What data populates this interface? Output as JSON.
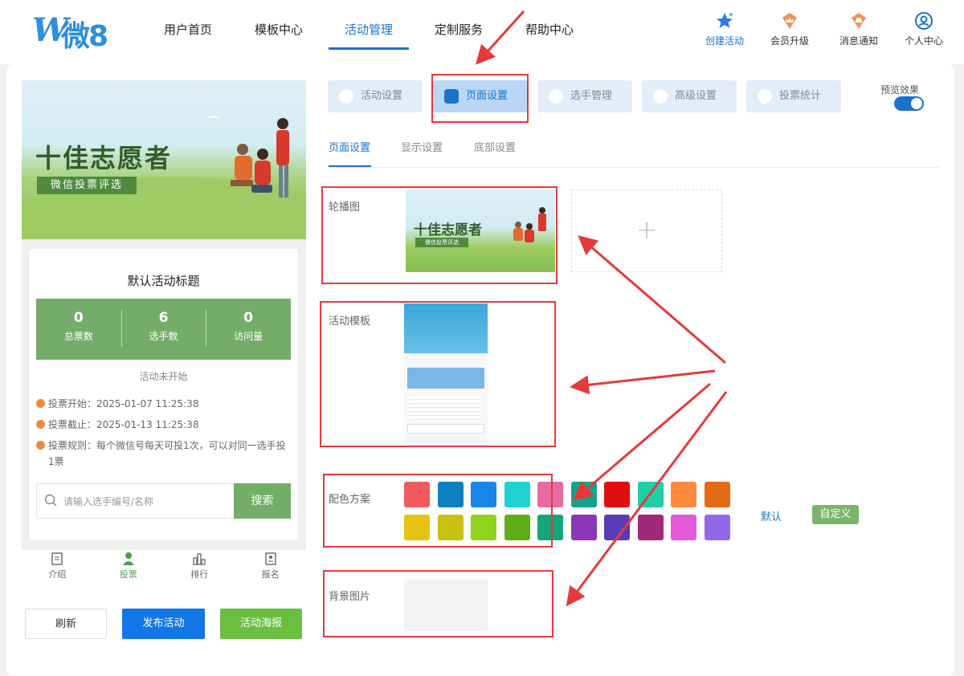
{
  "brand": {
    "logo_text": "微8",
    "logo_mark": "W"
  },
  "nav": {
    "items": [
      "用户首页",
      "模板中心",
      "活动管理",
      "定制服务",
      "帮助中心"
    ],
    "active_index": 2,
    "right": [
      {
        "label": "创建活动",
        "icon": "star-icon"
      },
      {
        "label": "会员升级",
        "icon": "crown-badge-icon"
      },
      {
        "label": "消息通知",
        "icon": "bell-badge-icon"
      },
      {
        "label": "个人中心",
        "icon": "user-circle-icon"
      }
    ]
  },
  "preview": {
    "banner_title": "十佳志愿者",
    "banner_subtitle": "微信投票评选",
    "activity_title": "默认活动标题",
    "stats": [
      {
        "value": "0",
        "label": "总票数"
      },
      {
        "value": "6",
        "label": "选手数"
      },
      {
        "value": "0",
        "label": "访问量"
      }
    ],
    "status": "活动未开始",
    "vote_start": "投票开始：2025-01-07 11:25:38",
    "vote_end": "投票截止：2025-01-13 11:25:38",
    "vote_rule": "投票规则：每个微信号每天可投1次，可以对同一选手投1票",
    "search_placeholder": "请输入选手编号/名称",
    "search_button": "搜索",
    "tabs": [
      "介绍",
      "投票",
      "排行",
      "报名"
    ],
    "active_tab_index": 1
  },
  "actions": {
    "refresh": "刷新",
    "publish": "发布活动",
    "poster": "活动海报"
  },
  "settings": {
    "tabs": [
      "活动设置",
      "页面设置",
      "选手管理",
      "高级设置",
      "投票统计"
    ],
    "active_tab_index": 1,
    "preview_toggle_label": "预览效果",
    "preview_toggle_on": true,
    "subtabs": [
      "页面设置",
      "显示设置",
      "底部设置"
    ],
    "active_subtab_index": 0,
    "fields": {
      "carousel": "轮播图",
      "template": "活动模板",
      "color_scheme": "配色方案",
      "background": "背景图片"
    },
    "carousel_thumb": {
      "title": "十佳志愿者",
      "subtitle": "微信投票评选"
    },
    "add_symbol": "+",
    "colors_row1": [
      "#f05a5a",
      "#0e7fc0",
      "#1a86e8",
      "#1ed2d2",
      "#e86aa0",
      "#13a38c",
      "#e00e0e",
      "#1fcfa6",
      "#ff8a3d",
      "#e36b12"
    ],
    "colors_row2": [
      "#e6c212",
      "#c9c110",
      "#8fd41a",
      "#5fad14",
      "#13a77a",
      "#8b36b6",
      "#5a3bb8",
      "#a1287a",
      "#e459d9",
      "#9467ea"
    ],
    "color_default": "默认",
    "color_custom": "自定义"
  }
}
